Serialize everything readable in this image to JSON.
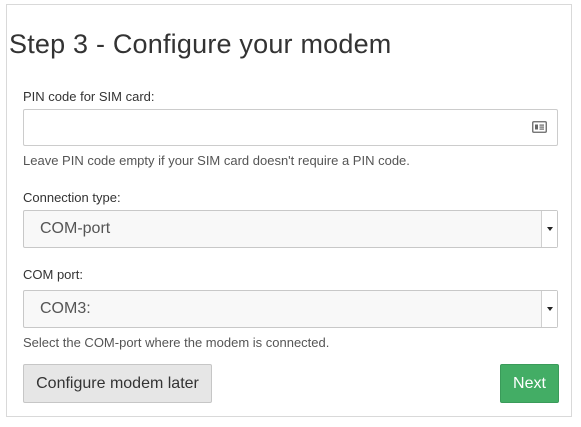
{
  "title": "Step 3 - Configure your modem",
  "pin": {
    "label": "PIN code for SIM card:",
    "value": "",
    "placeholder": "",
    "icon": "id-card-icon",
    "help": "Leave PIN code empty if your SIM card doesn't require a PIN code."
  },
  "connection_type": {
    "label": "Connection type:",
    "selected": "COM-port"
  },
  "com_port": {
    "label": "COM port:",
    "selected": "COM3:",
    "help": "Select the COM-port where the modem is connected."
  },
  "buttons": {
    "later_label": "Configure modem later",
    "next_label": "Next"
  },
  "colors": {
    "next_button": "#43ad65",
    "secondary_button": "#e6e6e6",
    "border": "#cccccc"
  }
}
